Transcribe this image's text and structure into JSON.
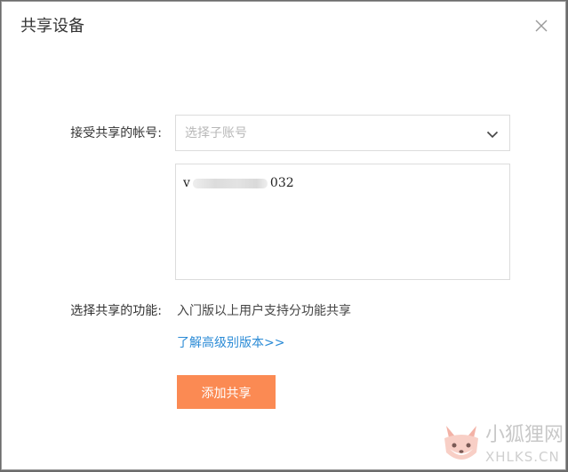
{
  "dialog": {
    "title": "共享设备",
    "close_icon": "close-icon"
  },
  "account": {
    "label": "接受共享的帐号:",
    "select_placeholder": "选择子账号",
    "chevron_icon": "chevron-down-icon",
    "textarea_prefix": "v",
    "textarea_suffix": "032"
  },
  "feature": {
    "label": "选择共享的功能:",
    "description": "入门版以上用户支持分功能共享",
    "link_text": "了解高级别版本>>"
  },
  "actions": {
    "add_label": "添加共享"
  },
  "watermark": {
    "text_cn": "小狐狸网",
    "text_en": "XHLKS.CN"
  },
  "colors": {
    "accent_button": "#fb8a53",
    "link": "#2b8bd6"
  }
}
